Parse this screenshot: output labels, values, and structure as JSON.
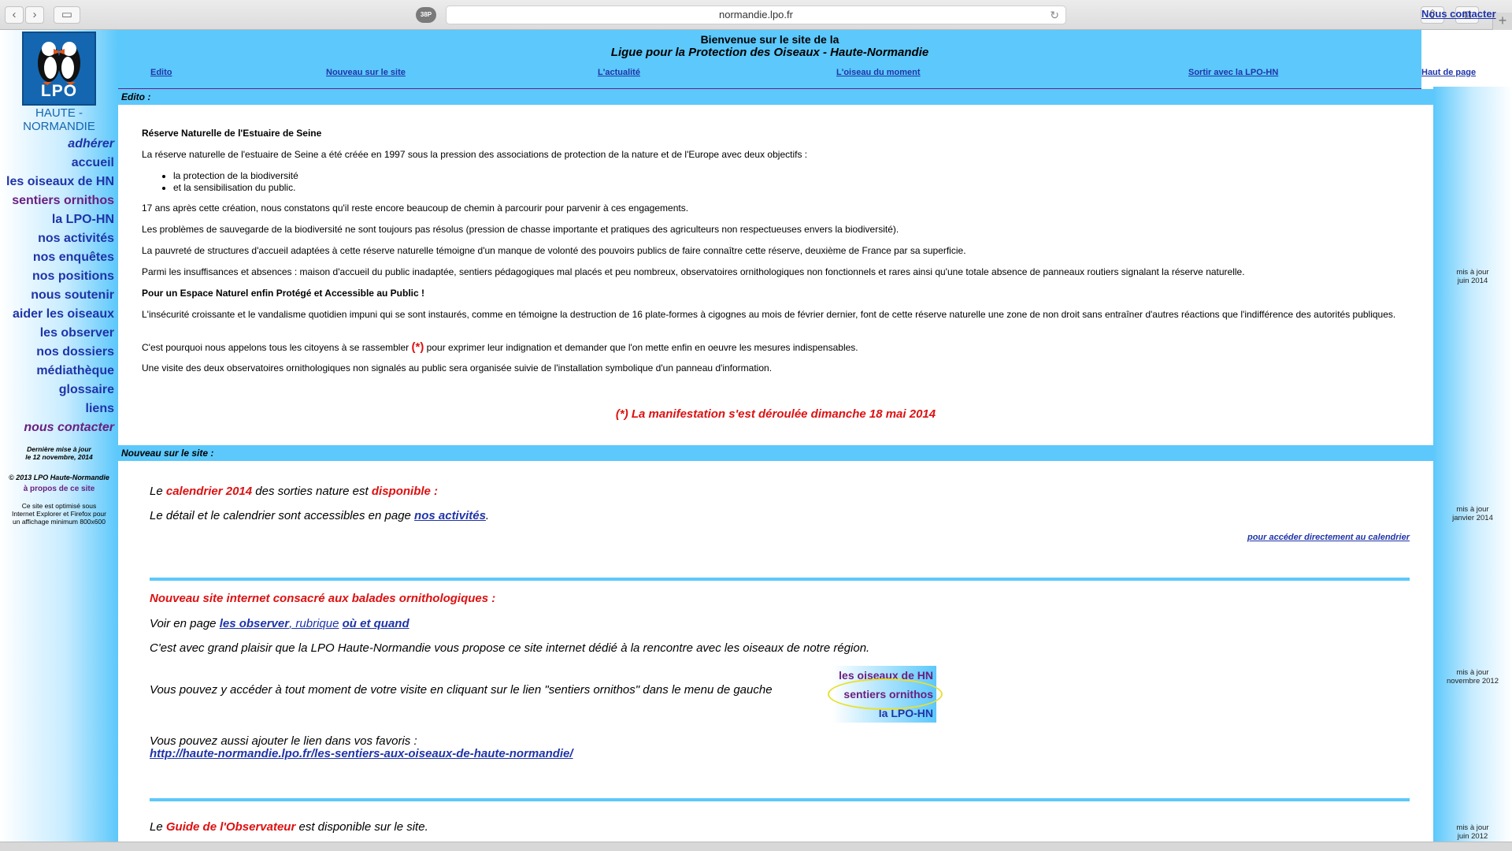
{
  "browser": {
    "url": "normandie.lpo.fr",
    "back": "‹",
    "forward": "›",
    "sidebar_toggle": "▭",
    "reader": "38P",
    "reload": "↻",
    "share": "⇧",
    "tabs": "⧉",
    "new_tab": "+"
  },
  "logo": {
    "text": "LPO",
    "subtitle_line1": "HAUTE -",
    "subtitle_line2": "NORMANDIE"
  },
  "nav": [
    {
      "label": "adhérer"
    },
    {
      "label": "accueil"
    },
    {
      "label": "les oiseaux de HN"
    },
    {
      "label": "sentiers ornithos"
    },
    {
      "label": "la LPO-HN"
    },
    {
      "label": "nos activités"
    },
    {
      "label": "nos enquêtes"
    },
    {
      "label": "nos positions"
    },
    {
      "label": "nous soutenir"
    },
    {
      "label": "aider les oiseaux"
    },
    {
      "label": "les observer"
    },
    {
      "label": "nos dossiers"
    },
    {
      "label": "médiathèque"
    },
    {
      "label": "glossaire"
    },
    {
      "label": "liens"
    },
    {
      "label": "nous contacter"
    }
  ],
  "sidebar_footer": {
    "last_update_1": "Dernière mise à jour",
    "last_update_2": "le 12 novembre, 2014",
    "copyright": "© 2013 LPO Haute-Normandie",
    "about": "à propos de ce site",
    "optimized_1": "Ce site est optimisé sous",
    "optimized_2": "Internet Explorer et Firefox pour",
    "optimized_3": "un affichage minimum 800x600"
  },
  "header": {
    "welcome_line1": "Bienvenue sur le site de la",
    "welcome_line2": "Ligue pour la Protection des Oiseaux - Haute-Normandie",
    "links": [
      "Edito",
      "Nouveau sur le site",
      "L'actualité",
      "L'oiseau du moment",
      "Sortir avec la LPO-HN"
    ],
    "contact": "Nous contacter",
    "top": "Haut de page"
  },
  "updates": [
    {
      "l1": "mis à jour",
      "l2": "juin 2014"
    },
    {
      "l1": "mis à jour",
      "l2": "janvier 2014"
    },
    {
      "l1": "mis à jour",
      "l2": "novembre 2012"
    },
    {
      "l1": "mis à jour",
      "l2": "juin 2012"
    }
  ],
  "edito": {
    "bar": "Edito :",
    "title": "Réserve Naturelle de l'Estuaire de Seine",
    "p1": "La réserve naturelle de l'estuaire de Seine a été créée en 1997 sous la pression des associations de protection de la nature et de l'Europe avec deux objectifs :",
    "bullet1": "la protection de la biodiversité",
    "bullet2": "et la sensibilisation du public.",
    "p2": "17 ans après cette création, nous constatons qu'il reste encore beaucoup de chemin à parcourir pour parvenir à ces engagements.",
    "p3": "Les problèmes de sauvegarde de la biodiversité ne sont toujours pas résolus (pression de chasse importante et pratiques des agriculteurs non respectueuses envers la biodiversité).",
    "p4": "La pauvreté de structures d'accueil adaptées à cette réserve naturelle témoigne d'un manque de volonté des pouvoirs publics de faire connaître cette réserve, deuxième de France par sa superficie.",
    "p5": "Parmi les insuffisances et absences : maison d'accueil du public inadaptée, sentiers pédagogiques mal placés et peu nombreux, observatoires ornithologiques non fonctionnels et rares ainsi qu'une totale absence de panneaux routiers signalant la réserve naturelle.",
    "subtitle": "Pour un Espace Naturel enfin Protégé et Accessible au Public !",
    "p6": "L'insécurité croissante et le vandalisme quotidien impuni qui se sont instaurés, comme en témoigne la destruction de 16 plate-formes à cigognes au mois de février dernier, font de cette réserve naturelle une zone de non droit sans entraîner d'autres réactions que l'indifférence des autorités publiques.",
    "p7a": "C'est pourquoi nous appelons tous les citoyens à se rassembler",
    "p7star": "(*)",
    "p7b": "pour exprimer leur indignation et demander que l'on mette enfin en oeuvre les mesures indispensables.",
    "p8": "Une visite des deux observatoires ornithologiques non signalés au public sera organisée suivie de l'installation symbolique d'un panneau d'information.",
    "manif": "(*) La manifestation s'est déroulée dimanche 18 mai 2014"
  },
  "nouveau": {
    "bar": "Nouveau sur le site :",
    "cal_a": "Le",
    "cal_b": "calendrier 2014",
    "cal_c": "des sorties nature est",
    "cal_d": "disponible :",
    "detail_a": "Le détail et le calendrier sont accessibles en page",
    "detail_link": "nos activités",
    "detail_end": ".",
    "cal_link": "pour accéder directement au calendrier",
    "site_title": "Nouveau site internet consacré aux balades ornithologiques :",
    "voir_a": "Voir en page",
    "voir_link1": "les observer",
    "voir_mid": ", rubrique",
    "voir_link2": "où et quand",
    "plaisir": "C'est avec grand plaisir que la LPO Haute-Normandie vous propose ce site internet dédié à la rencontre avec les oiseaux de notre région.",
    "acces": "Vous pouvez y accéder à tout moment de votre visite en cliquant sur le lien \"sentiers ornithos\" dans le menu de gauche",
    "mini1": "les oiseaux de HN",
    "mini2": "sentiers ornithos",
    "mini3": "la LPO-HN",
    "fav": "Vous pouvez aussi ajouter le lien dans vos favoris :",
    "fav_link": "http://haute-normandie.lpo.fr/les-sentiers-aux-oiseaux-de-haute-normandie/",
    "guide_a": "Le",
    "guide_b": "Guide de l'Observateur",
    "guide_c": "est disponible sur le site."
  }
}
